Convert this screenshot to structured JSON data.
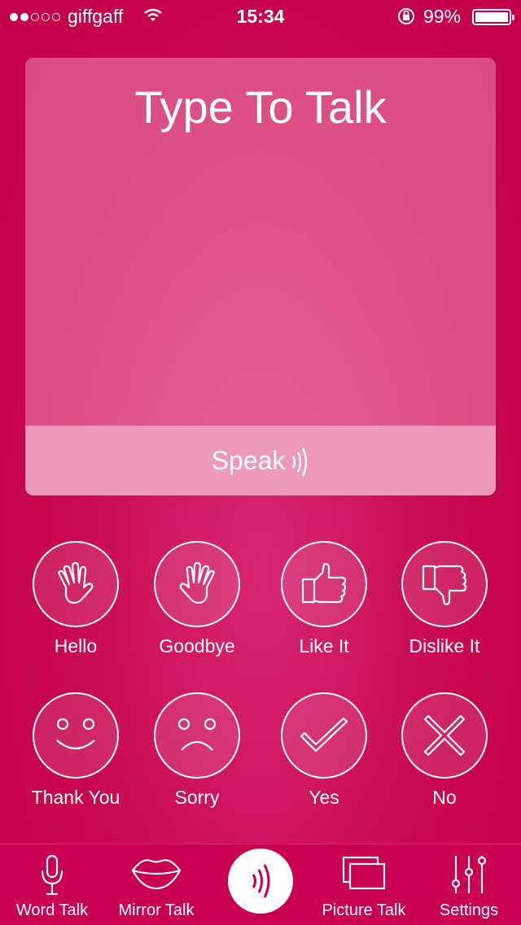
{
  "status_bar": {
    "carrier": "giffgaff",
    "time": "15:34",
    "battery": "99%",
    "signal_bars_filled": 2,
    "signal_bars_total": 5
  },
  "card": {
    "title": "Type To Talk",
    "speak_label": "Speak"
  },
  "phrases": [
    {
      "label": "Hello",
      "icon": "wave-hand-icon"
    },
    {
      "label": "Goodbye",
      "icon": "wave-hand-icon"
    },
    {
      "label": "Like It",
      "icon": "thumbs-up-icon"
    },
    {
      "label": "Dislike It",
      "icon": "thumbs-down-icon"
    },
    {
      "label": "Thank You",
      "icon": "smile-face-icon"
    },
    {
      "label": "Sorry",
      "icon": "sad-face-icon"
    },
    {
      "label": "Yes",
      "icon": "check-icon"
    },
    {
      "label": "No",
      "icon": "cross-icon"
    }
  ],
  "tabs": [
    {
      "label": "Word Talk",
      "icon": "microphone-icon"
    },
    {
      "label": "Mirror Talk",
      "icon": "lips-icon"
    },
    {
      "label": "Picture Talk",
      "icon": "pictures-icon"
    },
    {
      "label": "Settings",
      "icon": "sliders-icon"
    }
  ],
  "colors": {
    "background": "#c8074f",
    "accent": "#ffffff"
  }
}
